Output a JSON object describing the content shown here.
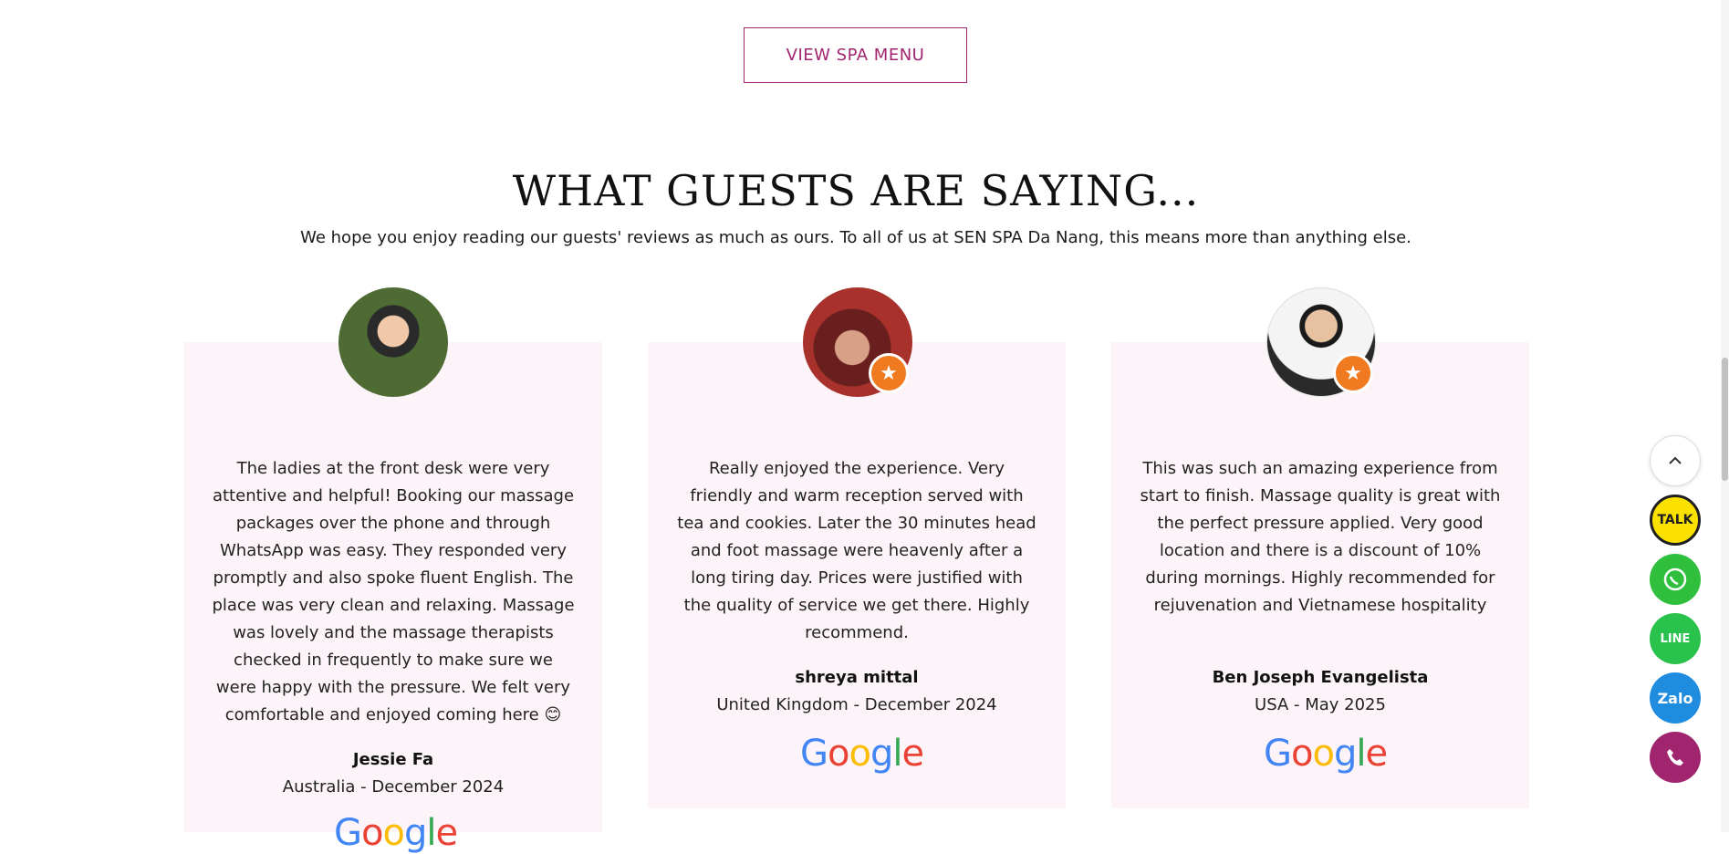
{
  "menu_button": {
    "label": "VIEW SPA MENU"
  },
  "section": {
    "title": "WHAT GUESTS ARE SAYING...",
    "subtitle": "We hope you enjoy reading our guests' reviews as much as ours. To all of us at SEN SPA Da Nang, this means more than anything else."
  },
  "reviews": [
    {
      "text": "The ladies at the front desk were very attentive and helpful! Booking our massage packages over the phone and through WhatsApp was easy. They responded very promptly and also spoke fluent English. The place was very clean and relaxing. Massage was lovely and the massage therapists checked in frequently to make sure we were happy with the pressure. We felt very comfortable and enjoyed coming here 😊",
      "name": "Jessie Fa",
      "origin": "Australia - December 2024"
    },
    {
      "text": "Really enjoyed the experience. Very friendly and warm reception served with tea and cookies. Later the 30 minutes head and foot massage were heavenly after a long tiring day. Prices were justified with the quality of service we get there. Highly recommend.",
      "name": "shreya mittal",
      "origin": "United Kingdom - December 2024"
    },
    {
      "text": "This was such an amazing experience from start to finish. Massage quality is great with the perfect pressure applied. Very good location and there is a discount of 10% during mornings. Highly recommended for rejuvenation and Vietnamese hospitality",
      "name": "Ben Joseph Evangelista",
      "origin": "USA - May 2025"
    }
  ],
  "google_logo": [
    "G",
    "o",
    "o",
    "g",
    "l",
    "e"
  ],
  "floating": {
    "up_icon": "chevron-up-icon",
    "talk_label": "TALK",
    "whatsapp_icon": "whatsapp-icon",
    "line_label": "LINE",
    "zalo_label": "Zalo",
    "phone_icon": "phone-icon"
  },
  "colors": {
    "accent": "#a0246e",
    "card_bg": "#fcf4f8",
    "badge": "#f07a1f"
  }
}
